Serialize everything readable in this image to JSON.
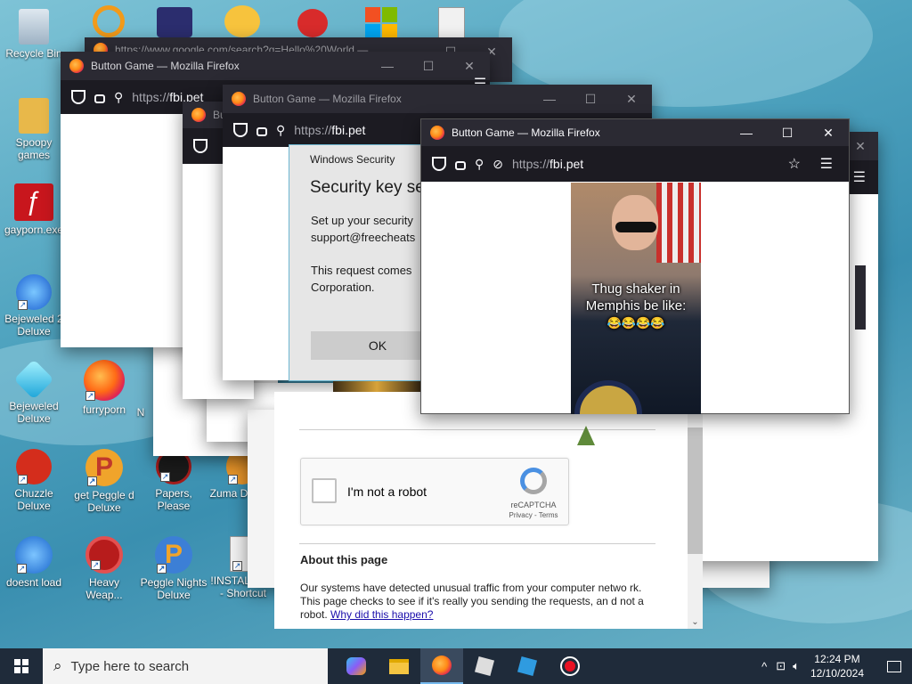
{
  "desktop": {
    "icons": [
      {
        "label": "Recycle Bin"
      },
      {
        "label": "Spoopy games"
      },
      {
        "label": "gayporn.exe"
      },
      {
        "label": "Bejeweled 2 Deluxe"
      },
      {
        "label": "Bejeweled Deluxe"
      },
      {
        "label": "furryporn"
      },
      {
        "label": "Chuzzle Deluxe"
      },
      {
        "label": "get Peggle d Deluxe"
      },
      {
        "label": "Papers, Please"
      },
      {
        "label": "Zuma D"
      },
      {
        "label": "doesnt load"
      },
      {
        "label": "Heavy Weap..."
      },
      {
        "label": "Peggle Nights Deluxe"
      },
      {
        "label": "!INSTALLIN... - Shortcut"
      },
      {
        "label": "N"
      }
    ]
  },
  "windows": {
    "google": {
      "title": "https://www.google.com/search?q=Hello%20World —"
    },
    "w1": {
      "title": "Button Game — Mozilla Firefox",
      "url_prefix": "https://",
      "url_host": "fbi.pet"
    },
    "w2": {
      "title": "Button Game — Mozilla Firefox",
      "url_prefix": "https://",
      "url_host": "fbi.pet"
    },
    "w3": {
      "title": "Bu"
    },
    "front": {
      "title": "Button Game — Mozilla Firefox",
      "url_prefix": "https://",
      "url_host": "fbi.pet",
      "meme_text": "Thug shaker in Memphis be like:",
      "meme_emoji": "😂😂😂😂"
    }
  },
  "security_dialog": {
    "header": "Windows Security",
    "title": "Security key se",
    "body1": "Set up your security",
    "body1b": "support@freecheats",
    "body2": "This request comes",
    "body2b": "Corporation.",
    "ok_label": "OK"
  },
  "captcha": {
    "checkbox_label": "I'm not a robot",
    "brand": "reCAPTCHA",
    "links": "Privacy - Terms",
    "about_title": "About this page",
    "about_text": "Our systems have detected unusual traffic from your computer netwo rk. This page checks to see if it's really you sending the requests, an d not a robot.",
    "why_link": "Why did this happen?"
  },
  "taskbar": {
    "search_placeholder": "Type here to search",
    "time": "12:24 PM",
    "date": "12/10/2024"
  },
  "colors": {
    "firefox_bar": "#2b2a33",
    "firefox_nav": "#1c1b22",
    "taskbar": "#1f2b3a",
    "link": "#1a0dab"
  }
}
